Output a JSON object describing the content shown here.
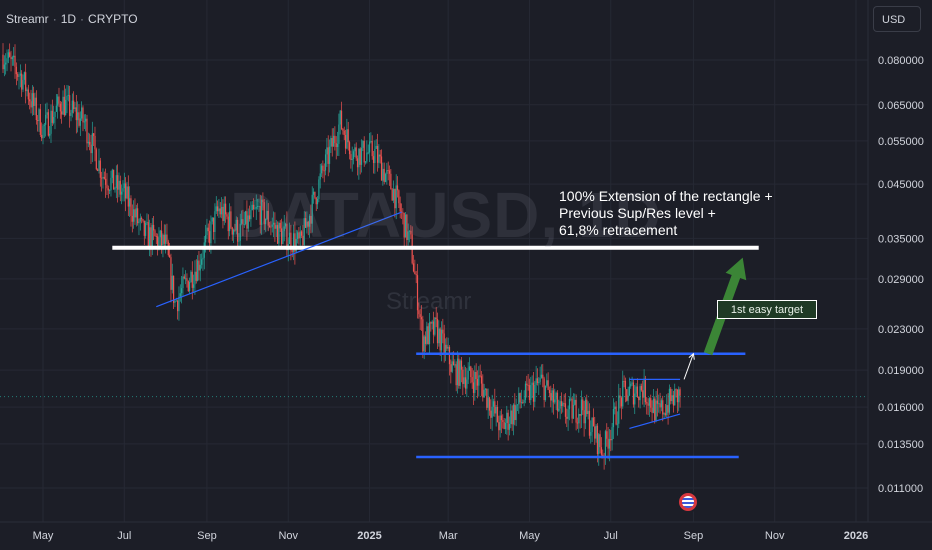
{
  "header": {
    "symbol": "Streamr",
    "interval": "1D",
    "exchange": "CRYPTO"
  },
  "currency_button": "USD",
  "watermark": {
    "ticker": "DATAUSD, 1D",
    "name": "Streamr"
  },
  "annotations": {
    "main": "100% Extension of the rectangle +\nPrevious Sup/Res level +\n61,8% retracement",
    "target_box": "1st easy target"
  },
  "colors": {
    "background": "#1c1e27",
    "up_candle": "#26a69a",
    "down_candle": "#ef5350",
    "trendline": "#2962ff",
    "level_line": "#ffffff",
    "arrow": "#3d8b37",
    "axis_text": "#d1d4dc",
    "last_price_line": "#26a69a"
  },
  "chart_data": {
    "type": "candlestick",
    "scale": "log",
    "x_ticks": [
      "May",
      "Jul",
      "Sep",
      "Nov",
      "2025",
      "Mar",
      "May",
      "Jul",
      "Sep",
      "Nov",
      "2026"
    ],
    "y_ticks": [
      "0.080000",
      "0.065000",
      "0.055000",
      "0.045000",
      "0.035000",
      "0.029000",
      "0.023000",
      "0.019000",
      "0.016000",
      "0.013500",
      "0.011000"
    ],
    "ylim": [
      0.0095,
      0.095
    ],
    "price_path": [
      [
        "2024-04-01",
        0.082
      ],
      [
        "2024-04-15",
        0.074
      ],
      [
        "2024-05-01",
        0.058
      ],
      [
        "2024-05-15",
        0.066
      ],
      [
        "2024-06-01",
        0.06
      ],
      [
        "2024-06-15",
        0.047
      ],
      [
        "2024-07-01",
        0.043
      ],
      [
        "2024-07-15",
        0.036
      ],
      [
        "2024-08-01",
        0.034
      ],
      [
        "2024-08-08",
        0.026
      ],
      [
        "2024-08-25",
        0.031
      ],
      [
        "2024-09-10",
        0.04
      ],
      [
        "2024-09-25",
        0.036
      ],
      [
        "2024-10-10",
        0.04
      ],
      [
        "2024-10-25",
        0.036
      ],
      [
        "2024-11-10",
        0.034
      ],
      [
        "2024-11-25",
        0.046
      ],
      [
        "2024-12-10",
        0.06
      ],
      [
        "2024-12-20",
        0.052
      ],
      [
        "2025-01-05",
        0.052
      ],
      [
        "2025-01-20",
        0.043
      ],
      [
        "2025-02-01",
        0.034
      ],
      [
        "2025-02-10",
        0.022
      ],
      [
        "2025-02-20",
        0.023
      ],
      [
        "2025-03-05",
        0.019
      ],
      [
        "2025-03-25",
        0.018
      ],
      [
        "2025-04-10",
        0.0145
      ],
      [
        "2025-04-25",
        0.0165
      ],
      [
        "2025-05-10",
        0.018
      ],
      [
        "2025-05-25",
        0.0155
      ],
      [
        "2025-06-10",
        0.016
      ],
      [
        "2025-06-25",
        0.013
      ],
      [
        "2025-07-10",
        0.017
      ],
      [
        "2025-07-25",
        0.0175
      ],
      [
        "2025-08-05",
        0.0155
      ],
      [
        "2025-08-15",
        0.0165
      ],
      [
        "2025-08-22",
        0.017
      ]
    ],
    "levels": [
      {
        "name": "target-level",
        "value": 0.0335,
        "from": "2024-06-22",
        "to": "2025-10-20",
        "color": "#ffffff"
      },
      {
        "name": "rectangle-top",
        "value": 0.0205,
        "from": "2025-02-05",
        "to": "2025-10-10",
        "color": "#2962ff"
      },
      {
        "name": "rectangle-bottom",
        "value": 0.0127,
        "from": "2025-02-05",
        "to": "2025-10-05",
        "color": "#2962ff"
      }
    ],
    "trendlines": [
      {
        "from": [
          "2024-07-25",
          0.0255
        ],
        "to": [
          "2025-01-25",
          0.0395
        ],
        "color": "#2962ff"
      },
      {
        "from": [
          "2025-07-15",
          0.0145
        ],
        "to": [
          "2025-08-22",
          0.0155
        ],
        "color": "#2962ff"
      },
      {
        "from": [
          "2025-07-15",
          0.0182
        ],
        "to": [
          "2025-08-22",
          0.0182
        ],
        "color": "#2962ff"
      }
    ],
    "arrows": [
      {
        "from": [
          "2025-09-12",
          0.0205
        ],
        "to": [
          "2025-10-08",
          0.032
        ],
        "color": "#3d8b37",
        "style": "thick"
      },
      {
        "from": [
          "2025-08-25",
          0.0182
        ],
        "to": [
          "2025-09-01",
          0.0205
        ],
        "color": "#ffffff",
        "style": "thin"
      }
    ],
    "last_price": 0.0168
  }
}
